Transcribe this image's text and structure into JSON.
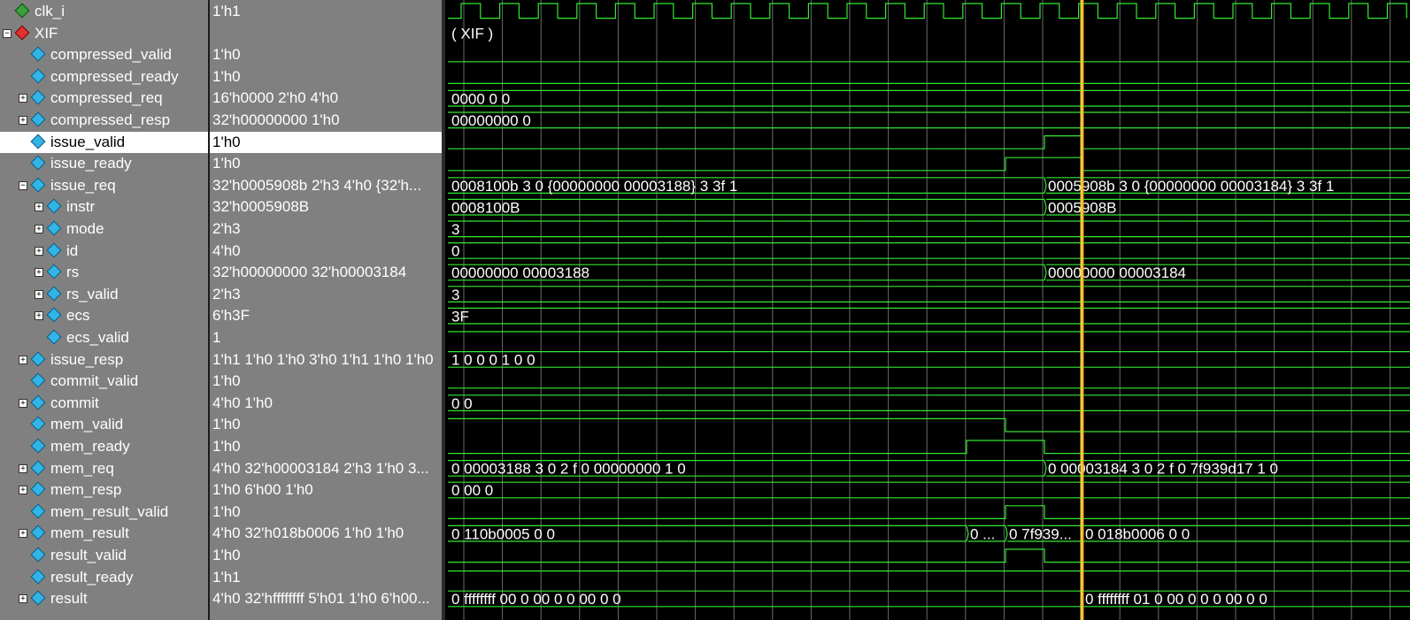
{
  "signals": [
    {
      "name": "clk_i",
      "value": "1'h1",
      "level": 0,
      "expander": "",
      "icon": "clk-icon",
      "wave": {
        "type": "clock"
      }
    },
    {
      "name": "XIF",
      "value": "",
      "level": 0,
      "expander": "−",
      "icon": "instance-icon",
      "wave": {
        "type": "label",
        "text": "( XIF )"
      }
    },
    {
      "name": "compressed_valid",
      "value": "1'h0",
      "level": 1,
      "expander": "",
      "icon": "signal-icon",
      "wave": {
        "type": "bit",
        "segs": [
          [
            0,
            1593,
            0
          ]
        ]
      }
    },
    {
      "name": "compressed_ready",
      "value": "1'h0",
      "level": 1,
      "expander": "",
      "icon": "signal-icon",
      "wave": {
        "type": "bit",
        "segs": [
          [
            0,
            1593,
            0
          ]
        ]
      }
    },
    {
      "name": "compressed_req",
      "value": "16'h0000 2'h0 4'h0",
      "level": 1,
      "expander": "+",
      "icon": "signal-icon",
      "wave": {
        "type": "bus",
        "segs": [
          {
            "text": "0000 0 0"
          }
        ]
      }
    },
    {
      "name": "compressed_resp",
      "value": "32'h00000000 1'h0",
      "level": 1,
      "expander": "+",
      "icon": "signal-icon",
      "wave": {
        "type": "bus",
        "segs": [
          {
            "text": "00000000 0"
          }
        ]
      }
    },
    {
      "name": "issue_valid",
      "value": "1'h0",
      "level": 1,
      "expander": "",
      "icon": "signal-icon",
      "selected": true,
      "wave": {
        "type": "bit",
        "segs": [
          [
            0,
            1180,
            0
          ],
          [
            1180,
            1222,
            1
          ],
          [
            1222,
            1593,
            0
          ]
        ]
      }
    },
    {
      "name": "issue_ready",
      "value": "1'h0",
      "level": 1,
      "expander": "",
      "icon": "signal-icon",
      "wave": {
        "type": "bit",
        "segs": [
          [
            0,
            1136,
            0
          ],
          [
            1136,
            1222,
            1
          ],
          [
            1222,
            1593,
            0
          ]
        ]
      }
    },
    {
      "name": "issue_req",
      "value": "32'h0005908b 2'h3 4'h0 {32'h...",
      "level": 1,
      "expander": "−",
      "icon": "signal-icon",
      "wave": {
        "type": "bus",
        "segs": [
          {
            "text": "0008100b 3 0 {00000000 00003188} 3 3f 1"
          },
          {
            "at": 1180,
            "text": "0005908b 3 0 {00000000 00003184} 3 3f 1"
          }
        ]
      }
    },
    {
      "name": "instr",
      "value": "32'h0005908B",
      "level": 2,
      "expander": "+",
      "icon": "signal-icon",
      "wave": {
        "type": "bus",
        "segs": [
          {
            "text": "0008100B"
          },
          {
            "at": 1180,
            "text": "0005908B"
          }
        ]
      }
    },
    {
      "name": "mode",
      "value": "2'h3",
      "level": 2,
      "expander": "+",
      "icon": "signal-icon",
      "wave": {
        "type": "bus",
        "segs": [
          {
            "text": "3"
          }
        ]
      }
    },
    {
      "name": "id",
      "value": "4'h0",
      "level": 2,
      "expander": "+",
      "icon": "signal-icon",
      "wave": {
        "type": "bus",
        "segs": [
          {
            "text": "0"
          }
        ]
      }
    },
    {
      "name": "rs",
      "value": "32'h00000000 32'h00003184",
      "level": 2,
      "expander": "+",
      "icon": "signal-icon",
      "wave": {
        "type": "bus",
        "segs": [
          {
            "text": "00000000 00003188"
          },
          {
            "at": 1180,
            "text": "00000000 00003184"
          }
        ]
      }
    },
    {
      "name": "rs_valid",
      "value": "2'h3",
      "level": 2,
      "expander": "+",
      "icon": "signal-icon",
      "wave": {
        "type": "bus",
        "segs": [
          {
            "text": "3"
          }
        ]
      }
    },
    {
      "name": "ecs",
      "value": "6'h3F",
      "level": 2,
      "expander": "+",
      "icon": "signal-icon",
      "wave": {
        "type": "bus",
        "segs": [
          {
            "text": "3F"
          }
        ]
      }
    },
    {
      "name": "ecs_valid",
      "value": "1",
      "level": 2,
      "expander": "",
      "icon": "signal-icon",
      "last": true,
      "wave": {
        "type": "bit",
        "segs": [
          [
            0,
            1593,
            1
          ]
        ]
      }
    },
    {
      "name": "issue_resp",
      "value": "1'h1 1'h0 1'h0 3'h0 1'h1 1'h0 1'h0",
      "level": 1,
      "expander": "+",
      "icon": "signal-icon",
      "wave": {
        "type": "bus",
        "segs": [
          {
            "text": "1 0 0 0 1 0 0"
          }
        ]
      }
    },
    {
      "name": "commit_valid",
      "value": "1'h0",
      "level": 1,
      "expander": "",
      "icon": "signal-icon",
      "wave": {
        "type": "bit",
        "segs": [
          [
            0,
            1593,
            0
          ]
        ]
      }
    },
    {
      "name": "commit",
      "value": "4'h0 1'h0",
      "level": 1,
      "expander": "+",
      "icon": "signal-icon",
      "wave": {
        "type": "bus",
        "segs": [
          {
            "text": "0 0"
          }
        ]
      }
    },
    {
      "name": "mem_valid",
      "value": "1'h0",
      "level": 1,
      "expander": "",
      "icon": "signal-icon",
      "wave": {
        "type": "bit",
        "segs": [
          [
            0,
            1136,
            1
          ],
          [
            1136,
            1593,
            0
          ]
        ]
      }
    },
    {
      "name": "mem_ready",
      "value": "1'h0",
      "level": 1,
      "expander": "",
      "icon": "signal-icon",
      "wave": {
        "type": "bit",
        "segs": [
          [
            0,
            1092,
            0
          ],
          [
            1092,
            1180,
            1
          ],
          [
            1180,
            1593,
            0
          ]
        ]
      }
    },
    {
      "name": "mem_req",
      "value": "4'h0 32'h00003184 2'h3 1'h0 3...",
      "level": 1,
      "expander": "+",
      "icon": "signal-icon",
      "wave": {
        "type": "bus",
        "segs": [
          {
            "text": "0 00003188 3 0 2 f 0 00000000 1 0"
          },
          {
            "at": 1180,
            "text": "0 00003184 3 0 2 f 0 7f939d17 1 0"
          }
        ]
      }
    },
    {
      "name": "mem_resp",
      "value": "1'h0 6'h00 1'h0",
      "level": 1,
      "expander": "+",
      "icon": "signal-icon",
      "wave": {
        "type": "bus",
        "segs": [
          {
            "text": "0 00 0"
          }
        ]
      }
    },
    {
      "name": "mem_result_valid",
      "value": "1'h0",
      "level": 1,
      "expander": "",
      "icon": "signal-icon",
      "wave": {
        "type": "bit",
        "segs": [
          [
            0,
            1136,
            0
          ],
          [
            1136,
            1180,
            1
          ],
          [
            1180,
            1593,
            0
          ]
        ]
      }
    },
    {
      "name": "mem_result",
      "value": "4'h0 32'h018b0006 1'h0 1'h0",
      "level": 1,
      "expander": "+",
      "icon": "signal-icon",
      "wave": {
        "type": "bus",
        "segs": [
          {
            "text": "0 110b0005 0 0"
          },
          {
            "at": 1092,
            "text": "0 ..."
          },
          {
            "at": 1136,
            "text": "0 7f939..."
          },
          {
            "at": 1222,
            "text": "0 018b0006 0 0"
          }
        ]
      }
    },
    {
      "name": "result_valid",
      "value": "1'h0",
      "level": 1,
      "expander": "",
      "icon": "signal-icon",
      "wave": {
        "type": "bit",
        "segs": [
          [
            0,
            1136,
            0
          ],
          [
            1136,
            1180,
            1
          ],
          [
            1180,
            1593,
            0
          ]
        ]
      }
    },
    {
      "name": "result_ready",
      "value": "1'h1",
      "level": 1,
      "expander": "",
      "icon": "signal-icon",
      "wave": {
        "type": "bit",
        "segs": [
          [
            0,
            1593,
            1
          ]
        ]
      }
    },
    {
      "name": "result",
      "value": "4'h0 32'hffffffff 5'h01 1'h0 6'h00...",
      "level": 1,
      "expander": "+",
      "icon": "signal-icon",
      "wave": {
        "type": "bus",
        "segs": [
          {
            "text": "0 ffffffff 00 0 00 0 0 00 0 0"
          },
          {
            "at": 1222,
            "text": "0 ffffffff 01 0 00 0 0 0 00 0 0"
          }
        ]
      }
    }
  ],
  "colors": {
    "wave": "#33e833",
    "grid": "#6a6a6a",
    "cursor": "#e8d23a",
    "panel": "#808080",
    "selected_bg": "#ffffff"
  }
}
